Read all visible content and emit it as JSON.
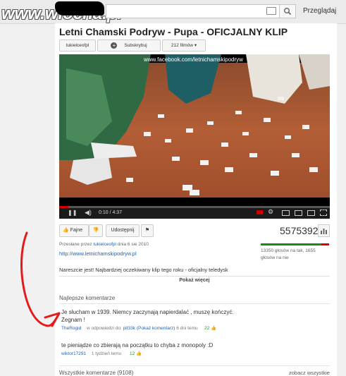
{
  "watermark": "www.wiocha.pl",
  "header": {
    "browse_label": "Przeglądaj"
  },
  "video": {
    "title": "Letni Chamski Podryw - Pupa - OFICJALNY KLIP",
    "overlay_text": "www.facebook.com/letnichamskipodryw",
    "time": "0:10 / 4:37",
    "progress_fraction": 0.035
  },
  "channel": {
    "name": "tukielceofpl",
    "subscribe_label": "Subskrybuj",
    "videos_label": "212 filmów"
  },
  "actions": {
    "like_label": "Fajne",
    "share_label": "Udostępnij",
    "views": "5575392"
  },
  "stats": {
    "like_text": "13350 głosów na tak, 1655",
    "dislike_text": "głosów na nie",
    "like_fraction": 0.89
  },
  "meta": {
    "uploaded_prefix": "Przesłane przez",
    "uploader": "tukielceofpl",
    "uploaded_suffix": "dnia 6 sie 2010",
    "link": "http://www.letnichamskipodryw.pl",
    "description": "Nareszcie jest! Najbardziej oczekiwany klip tego roku - oficjalny teledysk",
    "show_more": "Pokaż więcej"
  },
  "comments": {
    "top_header": "Najlepsze komentarze",
    "all_header": "Wszystkie komentarze (9108)",
    "show_all": "zobacz wszystkie",
    "items": [
      {
        "text_line1": "Je słucham w 1939. Niemcy zaczynają napierdalać , muszę kończyć.",
        "text_line2": "Żegnam !",
        "author": "TheRogid",
        "reply_prefix": "w odpowiedzi do:",
        "reply_to": "pit33k",
        "reply_note": "(Pokaż komentarz)",
        "time": "6 dni temu",
        "likes": "22"
      },
      {
        "text_line1": "te pieniądze co zbierają na początku to chyba z monopoly :D",
        "author": "wiktor17291",
        "time": "1 tydzień temu",
        "likes": "12"
      }
    ]
  }
}
